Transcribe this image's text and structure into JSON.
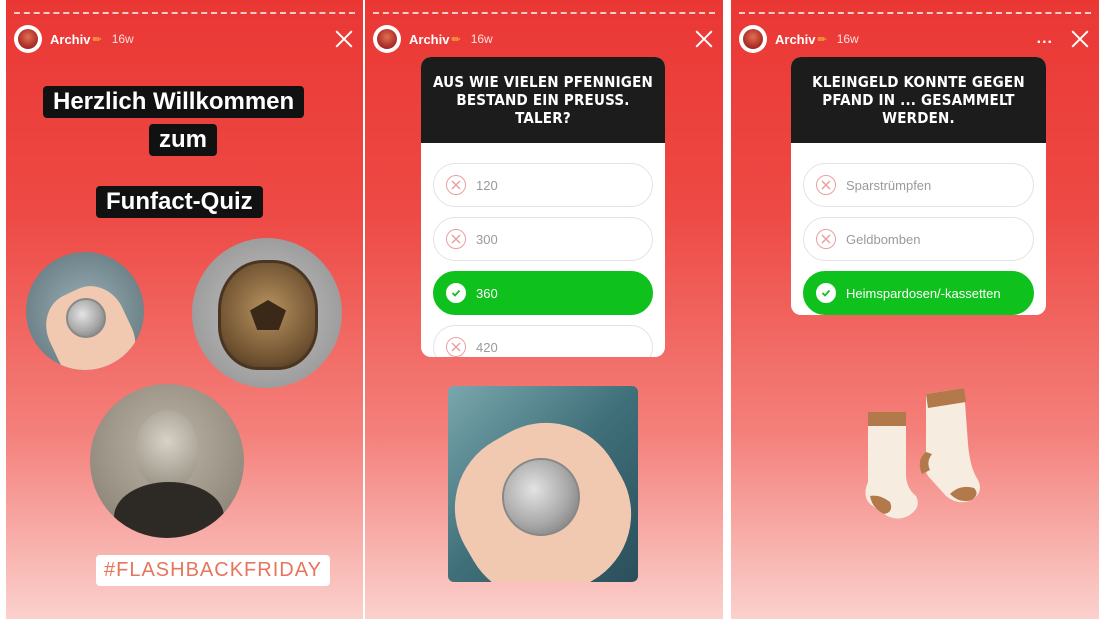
{
  "stories": [
    {
      "username": "Archiv",
      "pencil_icon": "pencil-icon",
      "time": "16w",
      "welcome_line1": "Herzlich Willkommen",
      "welcome_line2": "zum",
      "quiz_label": "Funfact-Quiz",
      "hashtag": "#FLASHBACKFRIDAY"
    },
    {
      "username": "Archiv",
      "pencil_icon": "pencil-icon",
      "time": "16w",
      "question": "AUS WIE VIELEN PFENNIGEN BESTAND EIN PREUSS. TALER?",
      "options": [
        {
          "label": "120",
          "state": "wrong"
        },
        {
          "label": "300",
          "state": "wrong"
        },
        {
          "label": "360",
          "state": "correct"
        },
        {
          "label": "420",
          "state": "wrong"
        }
      ]
    },
    {
      "username": "Archiv",
      "pencil_icon": "pencil-icon",
      "time": "16w",
      "more_label": "...",
      "question": "KLEINGELD KONNTE GEGEN PFAND IN ... GESAMMELT WERDEN.",
      "options": [
        {
          "label": "Sparstrümpfen",
          "state": "wrong"
        },
        {
          "label": "Geldbomben",
          "state": "wrong"
        },
        {
          "label": "Heimspardosen/-kassetten",
          "state": "correct"
        }
      ]
    }
  ],
  "colors": {
    "story_top": "#ea3734",
    "story_bottom": "#fbd1cd",
    "correct": "#0fc11c",
    "wrong_icon": "#e9a0a0",
    "hashtag": "#e8745c"
  }
}
